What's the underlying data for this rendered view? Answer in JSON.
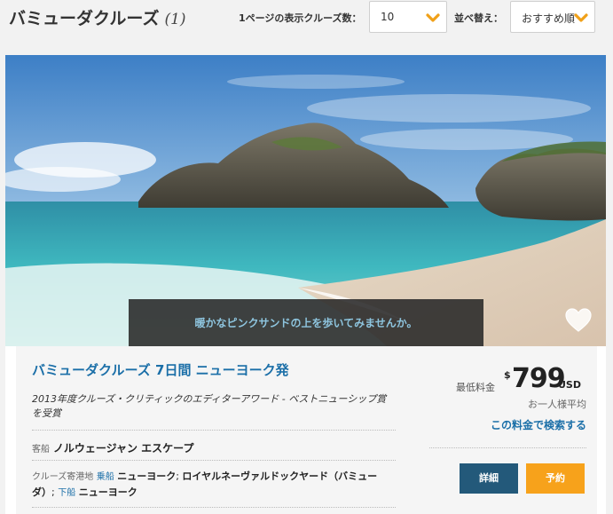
{
  "header": {
    "title": "バミューダクルーズ",
    "count": "(1)",
    "per_page_label": "1ページの表示クルーズ数：",
    "per_page_value": "10",
    "sort_label": "並べ替え：",
    "sort_value": "おすすめ順"
  },
  "hero": {
    "caption": "暖かなピンクサンドの上を歩いてみませんか。"
  },
  "cruise": {
    "title": "バミューダクルーズ 7日間 ニューヨーク発",
    "award": "2013年度クルーズ・クリティックのエディターアワード - ベストニューシップ賞を受賞",
    "ship_label": "客船",
    "ship_name": "ノルウェージャン エスケープ",
    "ports_label": "クルーズ寄港地",
    "embark_label": "乗船",
    "embark_port": "ニューヨーク",
    "sep_a": "; ",
    "middle_port": "ロイヤルネーヴァルドックヤード（バミューダ）",
    "sep_b": "; ",
    "disembark_label": "下船",
    "disembark_port": "ニューヨーク"
  },
  "price": {
    "label": "最低料金",
    "currency_symbol": "$",
    "amount": "799",
    "unit": "USD",
    "per_person": "お一人様平均",
    "search_link": "この料金で検索する"
  },
  "buttons": {
    "details": "詳細",
    "reserve": "予約"
  },
  "colors": {
    "accent_blue": "#1b6fa8",
    "button_dark": "#23597a",
    "button_orange": "#f7a21b",
    "chevron": "#f0a018"
  },
  "icons": {
    "dropdown": "chevron-down-icon",
    "favorite": "heart-icon"
  }
}
